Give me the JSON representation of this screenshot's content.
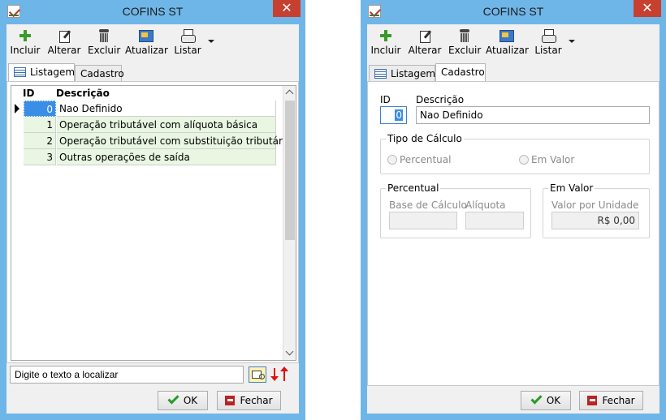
{
  "listing_window": {
    "title": "COFINS ST",
    "close_symbol": "✕",
    "toolbar": {
      "incluir": "Incluir",
      "alterar": "Alterar",
      "excluir": "Excluir",
      "atualizar": "Atualizar",
      "listar": "Listar"
    },
    "tabs": {
      "listagem": "Listagem",
      "cadastro": "Cadastro"
    },
    "grid": {
      "columns": {
        "id": "ID",
        "descricao": "Descrição"
      },
      "rows": [
        {
          "id": "0",
          "descricao": "Nao Definido"
        },
        {
          "id": "1",
          "descricao": "Operação tributável com alíquota básica"
        },
        {
          "id": "2",
          "descricao": "Operação tributável com substituição tributária"
        },
        {
          "id": "3",
          "descricao": "Outras operações de saída"
        }
      ]
    },
    "search": {
      "text": "Digite o texto a localizar"
    },
    "buttons": {
      "ok": "OK",
      "fechar": "Fechar"
    }
  },
  "form_window": {
    "title": "COFINS ST",
    "close_symbol": "✕",
    "toolbar": {
      "incluir": "Incluir",
      "alterar": "Alterar",
      "excluir": "Excluir",
      "atualizar": "Atualizar",
      "listar": "Listar"
    },
    "tabs": {
      "listagem": "Listagem",
      "cadastro": "Cadastro"
    },
    "form": {
      "id_label": "ID",
      "id_value": "0",
      "descricao_label": "Descrição",
      "descricao_value": "Nao Definido",
      "tipo_calculo": {
        "title": "Tipo de Cálculo",
        "percentual": "Percentual",
        "em_valor": "Em Valor"
      },
      "percentual_group": {
        "title": "Percentual",
        "base_calculo_label": "Base de Cálculo",
        "aliquota_label": "Alíquota"
      },
      "em_valor_group": {
        "title": "Em Valor",
        "valor_unidade_label": "Valor por Unidade",
        "valor_unidade_value": "R$ 0,00"
      }
    },
    "buttons": {
      "ok": "OK",
      "fechar": "Fechar"
    }
  },
  "colors": {
    "title_bar": "#6fb6e8",
    "close_button": "#c7402f",
    "selection": "#3a8ee6",
    "row_band": "#e8f6e2"
  }
}
